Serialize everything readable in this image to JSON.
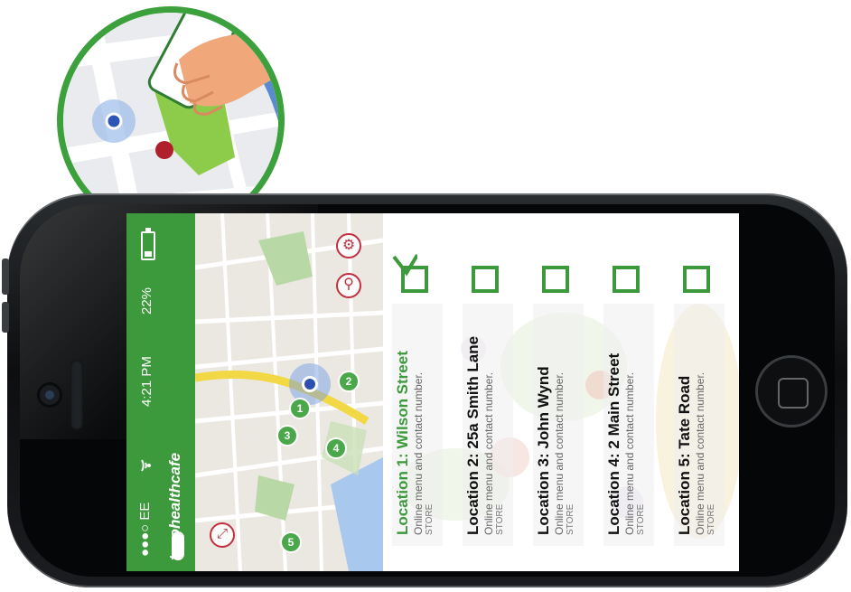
{
  "status_bar": {
    "carrier": "●●●○ EE",
    "time": "4:21 PM",
    "battery": "22%"
  },
  "brand": {
    "logo_text": "tacohealthcafe"
  },
  "map": {
    "markers": [
      {
        "label": "1"
      },
      {
        "label": "2"
      },
      {
        "label": "3"
      },
      {
        "label": "4"
      },
      {
        "label": "5"
      }
    ]
  },
  "locations": [
    {
      "title": "Location 1: Wilson Street",
      "subtitle": "Online menu and contact number.",
      "store": "STORE",
      "checked": true,
      "active": true
    },
    {
      "title": "Location 2: 25a Smith Lane",
      "subtitle": "Online menu and contact number.",
      "store": "STORE",
      "checked": false,
      "active": false
    },
    {
      "title": "Location 3: John Wynd",
      "subtitle": "Online menu and contact number.",
      "store": "STORE",
      "checked": false,
      "active": false
    },
    {
      "title": "Location 4: 2 Main Street",
      "subtitle": "Online menu and contact number.",
      "store": "STORE",
      "checked": false,
      "active": false
    },
    {
      "title": "Location 5: Tate Road",
      "subtitle": "Online menu and contact number.",
      "store": "STORE",
      "checked": false,
      "active": false
    }
  ],
  "colors": {
    "brand_green": "#3c9a3c",
    "accent_red": "#c03040",
    "location_blue": "#2d4fb0"
  }
}
